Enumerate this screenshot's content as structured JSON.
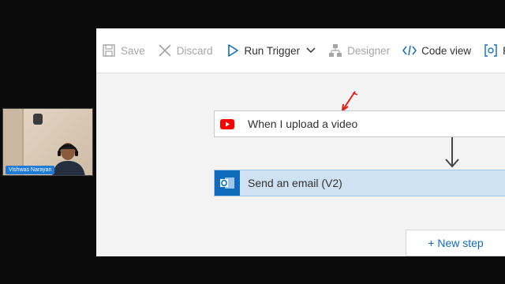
{
  "toolbar": {
    "save_label": "Save",
    "discard_label": "Discard",
    "run_trigger_label": "Run Trigger",
    "designer_label": "Designer",
    "code_view_label": "Code view",
    "parameters_label": "Pa"
  },
  "flow": {
    "trigger": {
      "title": "When I upload a video",
      "icon": "youtube-icon"
    },
    "action": {
      "title": "Send an email (V2)",
      "icon": "outlook-icon"
    },
    "new_step_label": "+ New step"
  },
  "webcam": {
    "participant_name": "Vishwas Narayan"
  },
  "colors": {
    "accent": "#0f6cbd",
    "action_card_bg": "#cfe2f3",
    "youtube_red": "#ff0000",
    "annotation_red": "#e0201b",
    "background": "#0b0b0b"
  }
}
